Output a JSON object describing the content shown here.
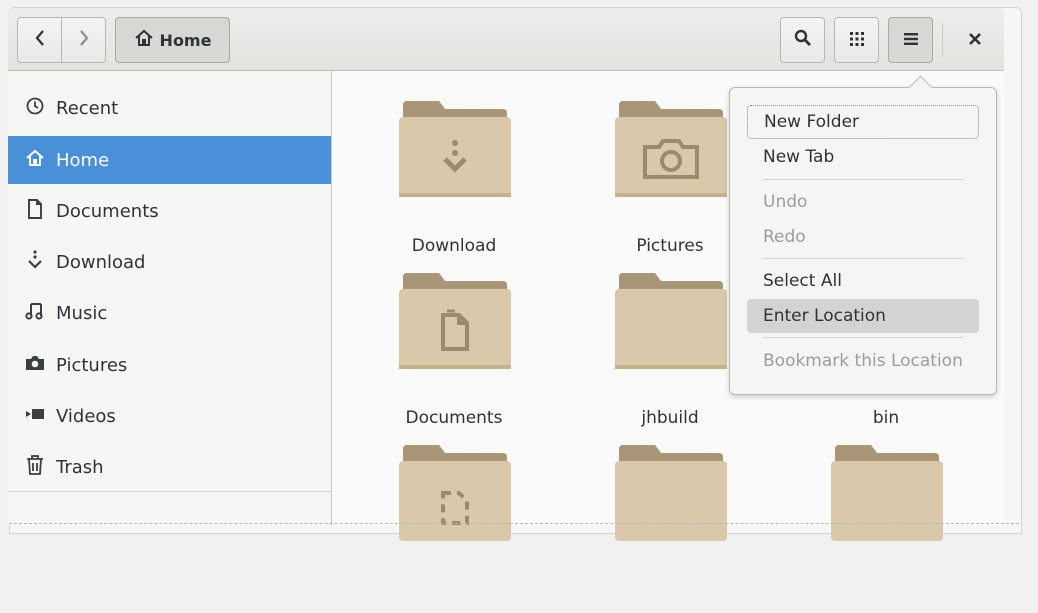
{
  "header": {
    "back_icon": "chevron-left-icon",
    "forward_icon": "chevron-right-icon",
    "path_label": "Home",
    "path_icon": "home-icon",
    "search_icon": "search-icon",
    "view_icon": "grid-icon",
    "menu_icon": "hamburger-icon",
    "close_icon": "close-icon"
  },
  "sidebar": {
    "items": [
      {
        "label": "Recent",
        "icon": "clock-icon"
      },
      {
        "label": "Home",
        "icon": "home-icon",
        "selected": true
      },
      {
        "label": "Documents",
        "icon": "document-icon"
      },
      {
        "label": "Download",
        "icon": "download-icon"
      },
      {
        "label": "Music",
        "icon": "music-icon"
      },
      {
        "label": "Pictures",
        "icon": "camera-icon"
      },
      {
        "label": "Videos",
        "icon": "video-icon"
      },
      {
        "label": "Trash",
        "icon": "trash-icon"
      }
    ]
  },
  "folders": [
    {
      "label": "Download",
      "emblem": "download-icon"
    },
    {
      "label": "Pictures",
      "emblem": "camera-icon"
    },
    {
      "label": "",
      "emblem": ""
    },
    {
      "label": "Documents",
      "emblem": "document-icon"
    },
    {
      "label": "jhbuild",
      "emblem": ""
    },
    {
      "label": "bin",
      "emblem": ""
    },
    {
      "label": "",
      "emblem": "template-icon"
    },
    {
      "label": "",
      "emblem": ""
    },
    {
      "label": "",
      "emblem": ""
    }
  ],
  "menu": {
    "items": [
      {
        "label": "New Folder",
        "state": "focused"
      },
      {
        "label": "New Tab",
        "state": "normal"
      },
      {
        "label": "Undo",
        "state": "disabled"
      },
      {
        "label": "Redo",
        "state": "disabled"
      },
      {
        "label": "Select All",
        "state": "normal"
      },
      {
        "label": "Enter Location",
        "state": "hover"
      },
      {
        "label": "Bookmark this Location",
        "state": "disabled"
      }
    ]
  },
  "colors": {
    "accent": "#4a90d9",
    "folder_body": "#d9c9aa",
    "folder_tab": "#a99578",
    "emblem": "#9b8a6d"
  }
}
